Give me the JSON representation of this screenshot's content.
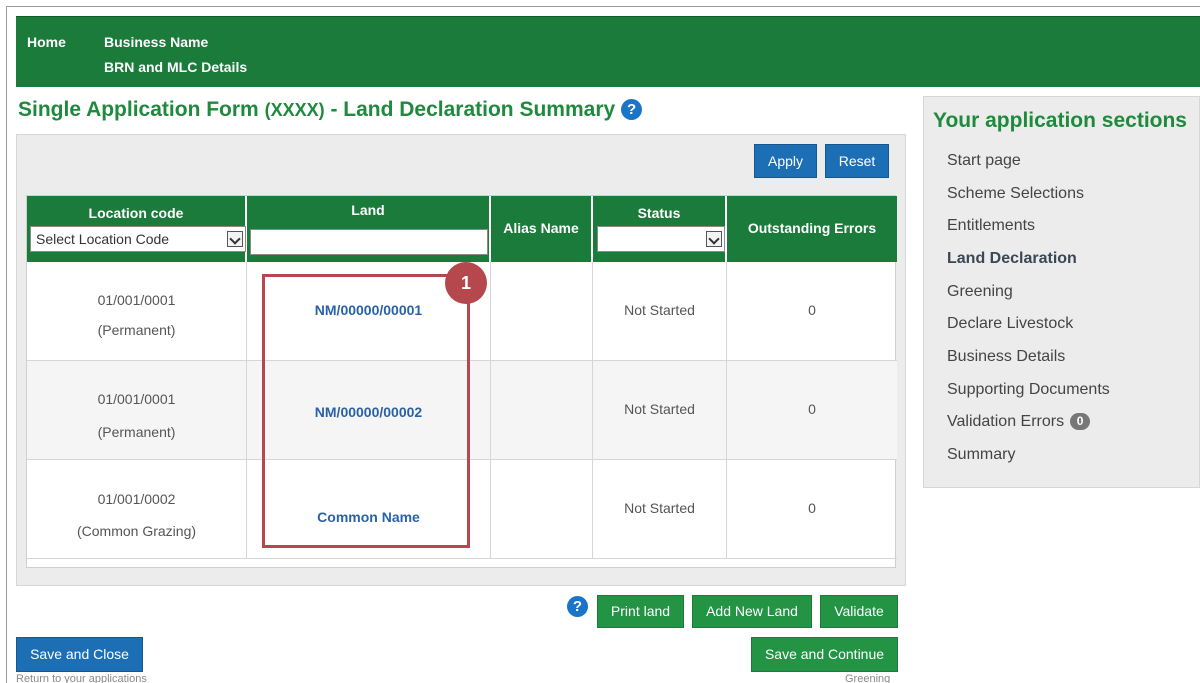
{
  "header": {
    "home": "Home",
    "business_name": "Business Name",
    "brn_mlc": "BRN and MLC Details"
  },
  "page": {
    "title_main": "Single Application Form",
    "title_code": "(XXXX)",
    "title_rest": "- Land Declaration Summary",
    "help_glyph": "?"
  },
  "filters": {
    "apply": "Apply",
    "reset": "Reset"
  },
  "table": {
    "columns": [
      "Location code",
      "Land",
      "Alias Name",
      "Status",
      "Outstanding Errors"
    ],
    "location_select": "Select Location Code",
    "land_filter_value": "",
    "status_select": "",
    "rows": [
      {
        "code": "01/001/0001",
        "type": "(Permanent)",
        "land": "NM/00000/00001",
        "alias": "",
        "status": "Not Started",
        "errors": "0"
      },
      {
        "code": "01/001/0001",
        "type": "(Permanent)",
        "land": "NM/00000/00002",
        "alias": "",
        "status": "Not Started",
        "errors": "0"
      },
      {
        "code": "01/001/0002",
        "type": "(Common Grazing)",
        "land": "Common Name",
        "alias": "",
        "status": "Not Started",
        "errors": "0"
      }
    ]
  },
  "annotation": {
    "badge": "1",
    "color": "#b5484d"
  },
  "actions": {
    "help_glyph": "?",
    "print_land": "Print land",
    "add_new_land": "Add New Land",
    "validate": "Validate",
    "save_close": "Save and Close",
    "save_close_hint": "Return to your applications",
    "save_continue": "Save and Continue",
    "save_continue_hint": "Greening"
  },
  "sidebar": {
    "title": "Your application sections",
    "items": [
      {
        "label": "Start page",
        "active": false
      },
      {
        "label": "Scheme Selections",
        "active": false
      },
      {
        "label": "Entitlements",
        "active": false
      },
      {
        "label": "Land Declaration",
        "active": true
      },
      {
        "label": "Greening",
        "active": false
      },
      {
        "label": "Declare Livestock",
        "active": false
      },
      {
        "label": "Business Details",
        "active": false
      },
      {
        "label": "Supporting Documents",
        "active": false
      },
      {
        "label": "Validation Errors",
        "active": false,
        "count": "0"
      },
      {
        "label": "Summary",
        "active": false
      }
    ]
  },
  "colors": {
    "brand_green": "#1a7b3a",
    "title_green": "#1f8a3e",
    "action_blue": "#1d6fb5",
    "link_blue": "#2a62a8"
  }
}
